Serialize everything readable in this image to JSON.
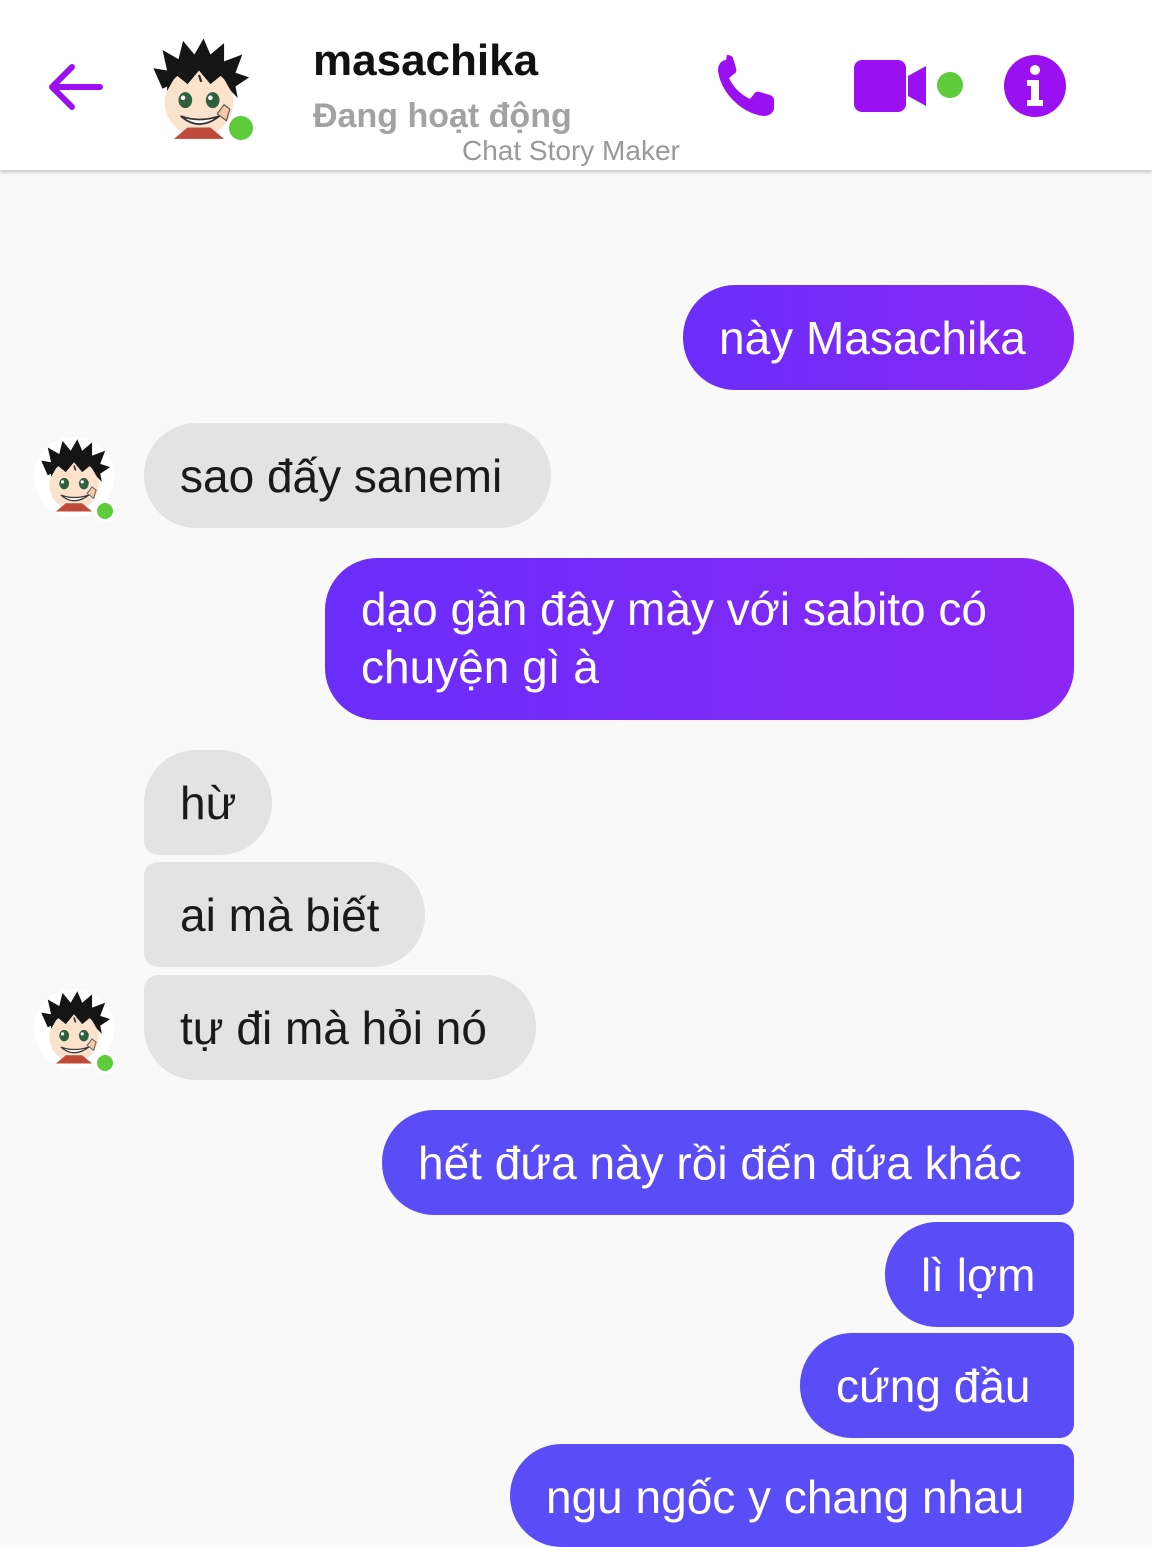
{
  "header": {
    "contact_name": "masachika",
    "status": "Đang hoạt động",
    "watermark": "Chat Story Maker",
    "back_icon": "back-arrow-icon",
    "call_icon": "phone-icon",
    "video_icon": "video-camera-icon",
    "info_icon": "info-icon"
  },
  "colors": {
    "accent": "#9b10f2",
    "outgoing_purple": "#7b2af8",
    "outgoing_blue": "#5a4cf7",
    "incoming": "#e3e3e3",
    "online": "#5ecb3b"
  },
  "messages": [
    {
      "from": "me",
      "text": "này Masachika"
    },
    {
      "from": "them",
      "text": "sao đấy sanemi"
    },
    {
      "from": "me",
      "line1": "dạo gần đây mày với sabito có",
      "line2": "chuyện gì à"
    },
    {
      "from": "them",
      "text": "hừ"
    },
    {
      "from": "them",
      "text": "ai mà biết"
    },
    {
      "from": "them",
      "text": "tự đi mà hỏi nó"
    },
    {
      "from": "me",
      "text": "hết đứa này rồi đến đứa khác"
    },
    {
      "from": "me",
      "text": "lì lợm"
    },
    {
      "from": "me",
      "text": "cứng đầu"
    },
    {
      "from": "me",
      "text": "ngu ngốc y chang nhau"
    }
  ]
}
